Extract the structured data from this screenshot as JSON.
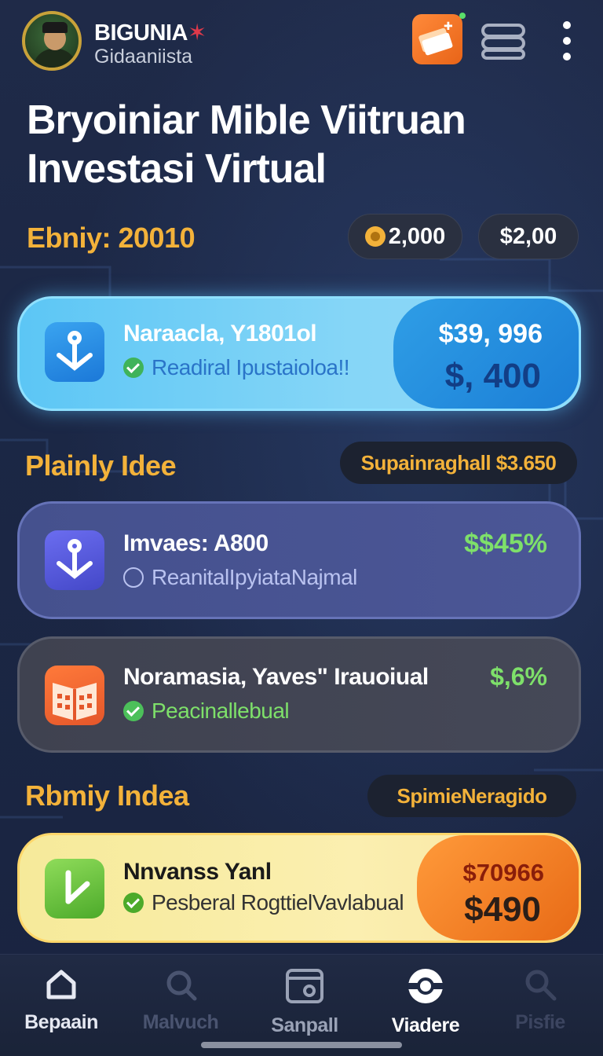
{
  "header": {
    "user_name": "BIGUNIA",
    "user_name_mark": "✶",
    "user_subtitle": "Gidaaniista",
    "icons": [
      "avatar",
      "orange-cards-icon",
      "stack-icon",
      "more-vertical-icon"
    ]
  },
  "title_line1": "Bryoiniar Mible Viitruan",
  "title_line2": "Investasi Virtual",
  "balance": {
    "label": "Ebniy: 20010",
    "coins": "2,000",
    "cash": "$2,00"
  },
  "card1": {
    "title": "Naraacla, Y1801ol",
    "subtitle": "Readiral Ipustaioloa!!",
    "amount_top": "$39, 996",
    "amount_main": "$, 400",
    "colors": {
      "accent": "#5cc6f5",
      "dark": "#1b7ed6"
    }
  },
  "section1": {
    "label": "Plainly Idee",
    "tag": "Supainraghall $3.650"
  },
  "card2": {
    "title": "Imvaes: A800",
    "subtitle": "ReanitalIpyiataNajmal",
    "percent": "$$45%"
  },
  "card3": {
    "title": "Noramasia, Yaves\" Irauoiual",
    "subtitle": "Peacinallebual",
    "percent": "$,6%"
  },
  "section2": {
    "label": "Rbmiy Indea",
    "tag": "SpimieNeragido"
  },
  "card4": {
    "title": "Nnvanss Yanl",
    "subtitle": "Pesberal RogttielVavlabual",
    "amount_top": "$70966",
    "amount_main": "$490"
  },
  "nav": {
    "items": [
      {
        "label": "Bepaain",
        "icon": "home-icon"
      },
      {
        "label": "Malvuch",
        "icon": "search-icon"
      },
      {
        "label": "Sanpall",
        "icon": "wallet-icon"
      },
      {
        "label": "Viadere",
        "icon": "target-icon"
      },
      {
        "label": "Pisfie",
        "icon": "profile-search-icon"
      }
    ]
  }
}
